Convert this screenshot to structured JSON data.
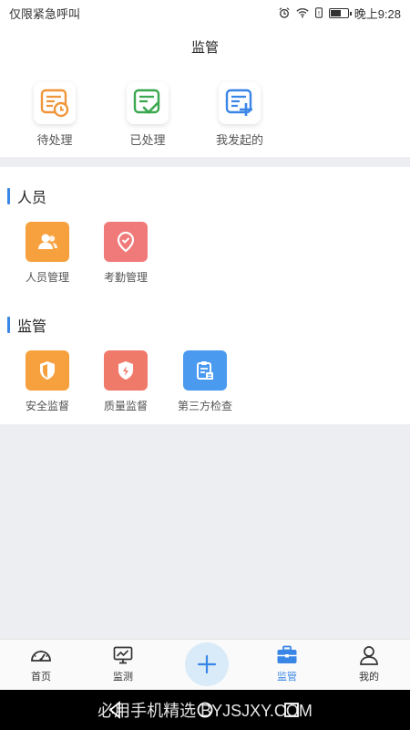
{
  "status_bar": {
    "carrier": "仅限紧急呼叫",
    "time": "晚上9:28",
    "battery_level": 0.55
  },
  "header": {
    "title": "监管"
  },
  "quick_actions": [
    {
      "label": "待处理",
      "icon": "pending-clock-icon",
      "color": "#f0953a"
    },
    {
      "label": "已处理",
      "icon": "processed-check-icon",
      "color": "#3aa84f"
    },
    {
      "label": "我发起的",
      "icon": "initiated-plus-icon",
      "color": "#3a86e6"
    }
  ],
  "sections": [
    {
      "title": "人员",
      "items": [
        {
          "label": "人员管理",
          "icon": "people-icon",
          "color": "#f6a13e"
        },
        {
          "label": "考勤管理",
          "icon": "location-pin-icon",
          "color": "#f07a7a"
        }
      ]
    },
    {
      "title": "监管",
      "items": [
        {
          "label": "安全监督",
          "icon": "shield-icon",
          "color": "#f6a13e"
        },
        {
          "label": "质量监督",
          "icon": "shield-bolt-icon",
          "color": "#f07a6a"
        },
        {
          "label": "第三方检查",
          "icon": "clipboard-icon",
          "color": "#4a9af0"
        }
      ]
    }
  ],
  "tab_bar": {
    "items": [
      {
        "label": "首页",
        "icon": "dashboard-icon"
      },
      {
        "label": "监测",
        "icon": "monitor-chart-icon"
      },
      {
        "label": "监管",
        "icon": "briefcase-icon",
        "active": true
      },
      {
        "label": "我的",
        "icon": "user-icon"
      }
    ],
    "accent": "#3a86e6"
  },
  "watermark": "必用手机精选 BYJSJXY.COM"
}
